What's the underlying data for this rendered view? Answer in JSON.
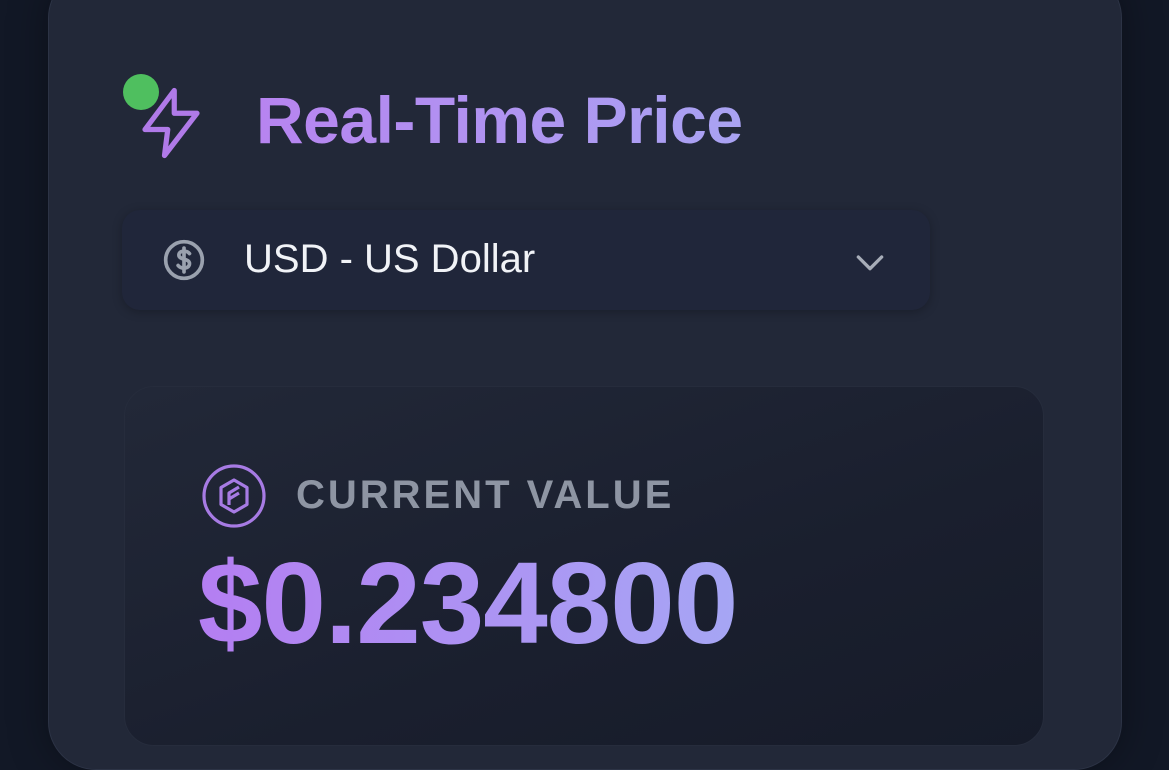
{
  "header": {
    "title": "Real-Time Price",
    "icon": "lightning-bolt-icon",
    "status_dot_color": "#4fbf5f"
  },
  "currency_select": {
    "icon": "dollar-circle-icon",
    "selected": "USD - US Dollar",
    "chevron": "chevron-down-icon"
  },
  "value_panel": {
    "icon": "token-coin-icon",
    "label": "CURRENT VALUE",
    "price": "$0.234800"
  },
  "colors": {
    "accent_start": "#b784f0",
    "accent_end": "#a9a3f2",
    "background": "#121826",
    "card": "#222838"
  }
}
